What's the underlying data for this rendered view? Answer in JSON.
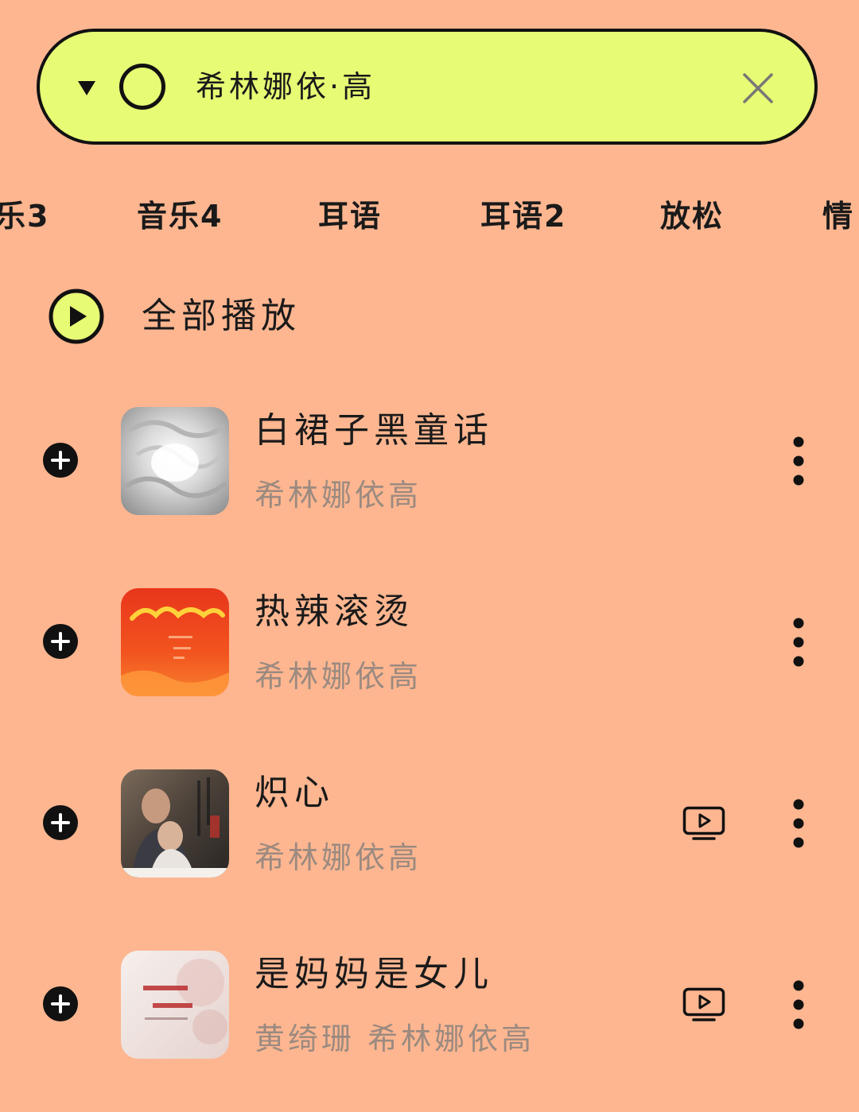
{
  "search": {
    "query": "希林娜依·高",
    "dropdown_icon": "triangle-down-icon",
    "ring_icon": "circle-outline-icon",
    "clear_icon": "close-icon"
  },
  "tabs": [
    {
      "label": "乐3"
    },
    {
      "label": "音乐4"
    },
    {
      "label": "耳语"
    },
    {
      "label": "耳语2"
    },
    {
      "label": "放松"
    },
    {
      "label": "情"
    }
  ],
  "play_all": {
    "label": "全部播放",
    "icon": "play-circle-icon"
  },
  "songs": [
    {
      "title": "白裙子黑童话",
      "artist": "希林娜依高",
      "has_mv": false
    },
    {
      "title": "热辣滚烫",
      "artist": "希林娜依高",
      "has_mv": false
    },
    {
      "title": "炽心",
      "artist": "希林娜依高",
      "has_mv": true
    },
    {
      "title": "是妈妈是女儿",
      "artist": "黄绮珊  希林娜依高",
      "has_mv": true
    }
  ],
  "colors": {
    "background": "#fdb690",
    "accent": "#e7fb74",
    "text": "#1a1a1a",
    "secondary_text": "#9b8a80"
  }
}
